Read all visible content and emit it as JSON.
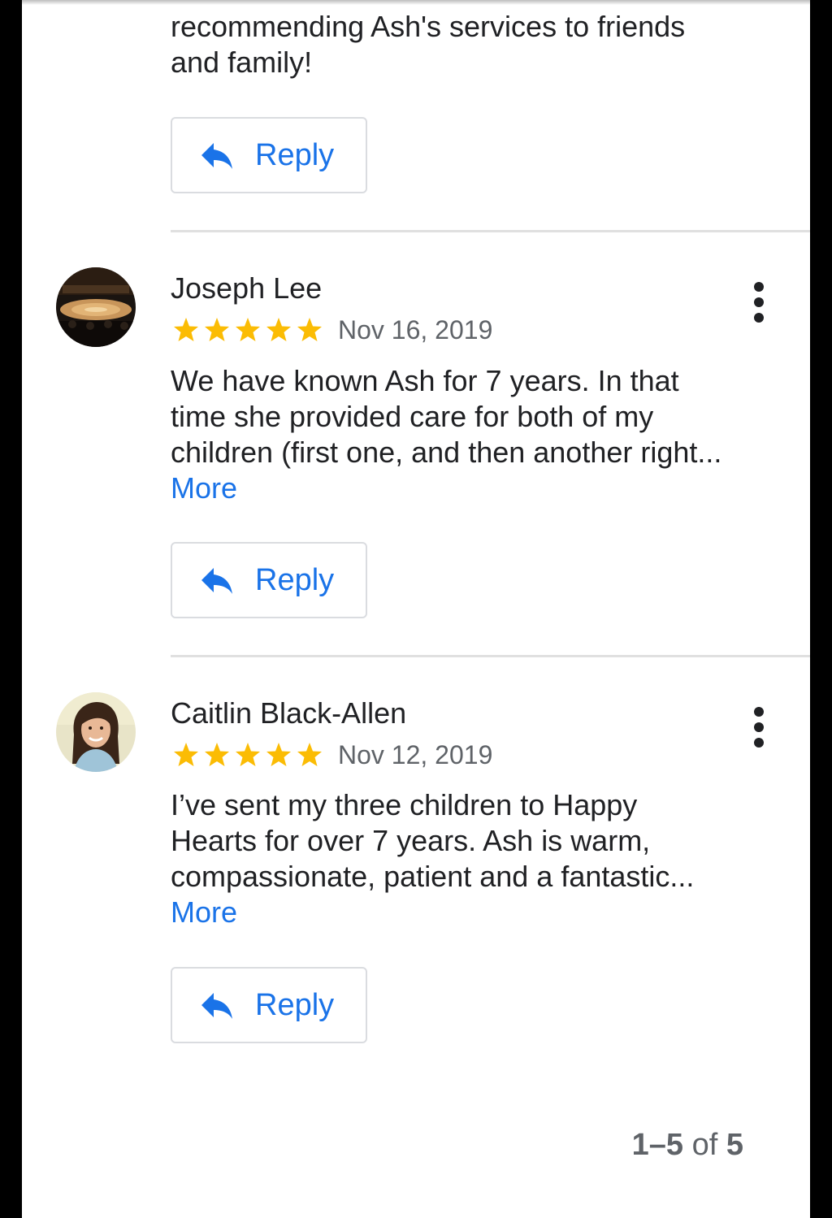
{
  "previous_review": {
    "text_tail_line1": "recommending Ash's services to friends",
    "text_tail_line2": "and family!",
    "reply_label": "Reply"
  },
  "reviews": [
    {
      "name": "Joseph Lee",
      "rating": 5,
      "date": "Nov 16, 2019",
      "text": "We have known Ash for 7 years. In that time she provided care for both of my children (first one, and then another right...",
      "more_label": "More",
      "reply_label": "Reply",
      "avatar": "arena-photo"
    },
    {
      "name": "Caitlin Black-Allen",
      "rating": 5,
      "date": "Nov 12, 2019",
      "text": "I’ve sent my three children to Happy Hearts for over 7 years. Ash is warm, compassionate, patient and a fantastic...",
      "more_label": "More",
      "reply_label": "Reply",
      "avatar": "woman-portrait-photo"
    }
  ],
  "pagination": {
    "range": "1–5",
    "of_label": "of",
    "total": "5"
  },
  "colors": {
    "link_blue": "#1a73e8",
    "star_yellow": "#fbbc04",
    "text_primary": "#202124",
    "text_secondary": "#5f6368",
    "divider": "#e0e0e0"
  },
  "icons": {
    "reply": "reply-arrow-icon",
    "menu": "more-vert-icon",
    "star": "star-icon"
  }
}
